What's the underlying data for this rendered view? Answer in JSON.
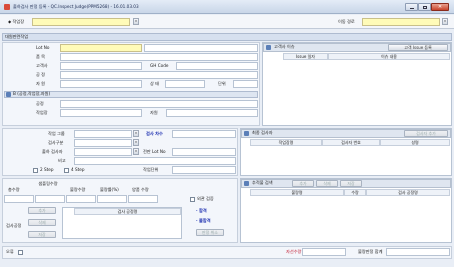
{
  "window": {
    "title": "출하검사 판정 등록 - QC.Inspect Judge(PPM5268) - 16.01.03.03",
    "icon": "app-icon",
    "controls": [
      "minimize",
      "maximize",
      "close"
    ]
  },
  "top": {
    "workplace_label": "◆ 작업장",
    "workplace_value": "",
    "route_label": "이동 경로",
    "route_value": ""
  },
  "section_title": "대원판련작업",
  "form": {
    "lot_no_label": "Lot No",
    "item_label": "품 목",
    "customer_label": "고객사",
    "process_label": "공 정",
    "material_label": "자 원",
    "gh_code_label": "GH Code",
    "status_label": "상 태",
    "unit_label": "단위"
  },
  "sub_section": {
    "title": "B (공정,작업장,자원)",
    "process_label": "공정",
    "workplace_label": "작업장",
    "resource_label": "자원"
  },
  "issue_panel": {
    "title": "고객사 이슈",
    "register_button": "고객 Issue 등록",
    "columns": [
      "Issue 일자",
      "이슈 내용"
    ]
  },
  "inspection": {
    "group_label": "작업 그룹",
    "type_label": "검사구분",
    "inspector_label": "출하 검사자",
    "remark_label": "비고",
    "count_label": "검사 차수",
    "prev_lot_label": "전판 Lot No",
    "step2_label": "2 Step",
    "step4_label": "4 Step",
    "work_unit_label": "작업단위"
  },
  "inspector_panel": {
    "title": "최종 검사자",
    "add_button": "검사자 추가",
    "columns": [
      "작업장명",
      "검사자 번호",
      "성명"
    ]
  },
  "quantities": {
    "total_label": "총수량",
    "sample_label": "샘플링수량",
    "defect_label": "불량수량",
    "defect_rate_label": "불량률(%)",
    "good_label": "양품 수량",
    "checked_label": "외관 검증"
  },
  "process_panel": {
    "label": "검사공정",
    "buttons": [
      "추가",
      "삭제",
      "저장"
    ],
    "header": "검사 공정명",
    "pass_label": "· 합격",
    "fail_label": "· 불합격",
    "cancel_button": "판정 취소"
  },
  "defect_panel": {
    "title": "추적불 검색",
    "buttons": [
      "추가",
      "삭제",
      "저장"
    ],
    "columns": [
      "불량명",
      "수량",
      "검사 공정명"
    ]
  },
  "footer": {
    "error_label": "오류",
    "defect_rate_label": "자선수량",
    "total_label": "불량판정 합계"
  },
  "colors": {
    "titlebar": "#d5e1f1",
    "accent": "#3a5a99",
    "required": "#fffbb8"
  }
}
